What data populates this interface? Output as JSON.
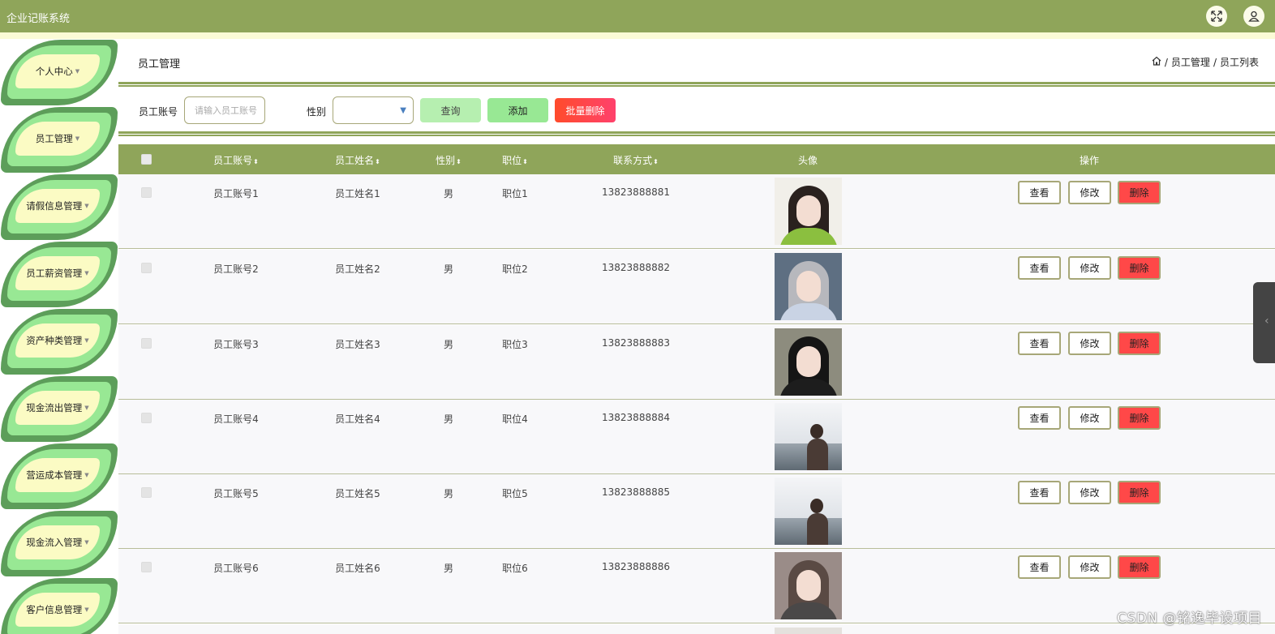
{
  "header": {
    "app_title": "企业记账系统",
    "fullscreen_icon": "expand-icon",
    "user_icon": "user-icon",
    "bar_color": "#8fa55a"
  },
  "sidebar": {
    "items": [
      {
        "label": "个人中心"
      },
      {
        "label": "员工管理"
      },
      {
        "label": "请假信息管理"
      },
      {
        "label": "员工薪资管理"
      },
      {
        "label": "资产种类管理"
      },
      {
        "label": "现金流出管理"
      },
      {
        "label": "营运成本管理"
      },
      {
        "label": "现金流入管理"
      },
      {
        "label": "客户信息管理"
      }
    ]
  },
  "page": {
    "title": "员工管理",
    "breadcrumb": [
      "员工管理",
      "员工列表"
    ]
  },
  "search": {
    "account_label": "员工账号",
    "account_placeholder": "请输入员工账号",
    "gender_label": "性别",
    "gender_value": "",
    "query_label": "查询",
    "add_label": "添加",
    "batch_delete_label": "批量删除"
  },
  "table": {
    "columns": [
      "员工账号",
      "员工姓名",
      "性别",
      "职位",
      "联系方式",
      "头像",
      "操作"
    ],
    "actions": {
      "view": "查看",
      "edit": "修改",
      "delete": "删除"
    },
    "rows": [
      {
        "account": "员工账号1",
        "name": "员工姓名1",
        "gender": "男",
        "position": "职位1",
        "phone": "13823888881"
      },
      {
        "account": "员工账号2",
        "name": "员工姓名2",
        "gender": "男",
        "position": "职位2",
        "phone": "13823888882"
      },
      {
        "account": "员工账号3",
        "name": "员工姓名3",
        "gender": "男",
        "position": "职位3",
        "phone": "13823888883"
      },
      {
        "account": "员工账号4",
        "name": "员工姓名4",
        "gender": "男",
        "position": "职位4",
        "phone": "13823888884"
      },
      {
        "account": "员工账号5",
        "name": "员工姓名5",
        "gender": "男",
        "position": "职位5",
        "phone": "13823888885"
      },
      {
        "account": "员工账号6",
        "name": "员工姓名6",
        "gender": "男",
        "position": "职位6",
        "phone": "13823888886"
      }
    ]
  },
  "watermark": "CSDN @铭逸毕设项目"
}
